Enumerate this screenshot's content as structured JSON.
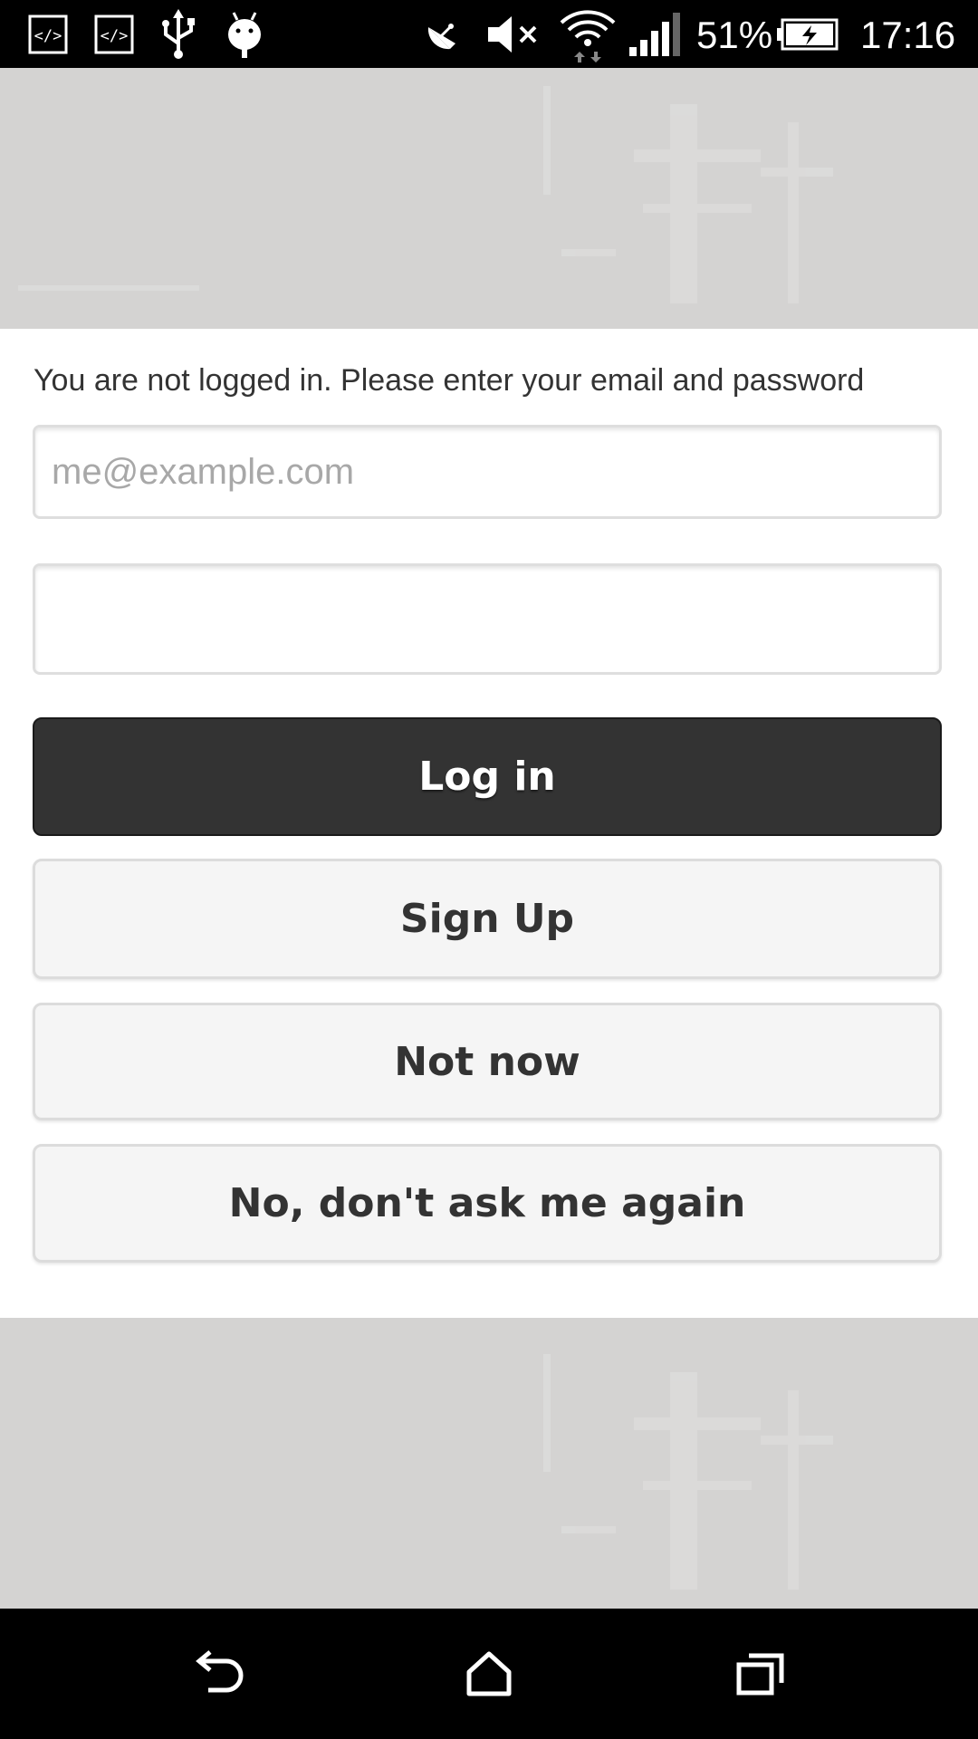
{
  "status_bar": {
    "icons": [
      "code-icon",
      "code-icon",
      "usb-icon",
      "android-debug-icon",
      "satellite-dish-icon",
      "volume-muted-icon",
      "wifi-icon",
      "cell-signal-icon",
      "battery-charging-icon"
    ],
    "battery_percent": "51%",
    "time": "17:16"
  },
  "login": {
    "prompt": "You are not logged in. Please enter your email and password",
    "email_placeholder": "me@example.com",
    "email_value": "",
    "password_value": "",
    "login_label": "Log in",
    "signup_label": "Sign Up",
    "not_now_label": "Not now",
    "never_label": "No, don't ask me again"
  },
  "nav_bar": {
    "icons": [
      "back-icon",
      "home-icon",
      "recents-icon"
    ]
  },
  "colors": {
    "background": "#d4d3d2",
    "card": "#ffffff",
    "primary_button": "#333333",
    "secondary_button": "#f5f5f5",
    "text": "#333333",
    "placeholder": "#a8a8a8"
  }
}
